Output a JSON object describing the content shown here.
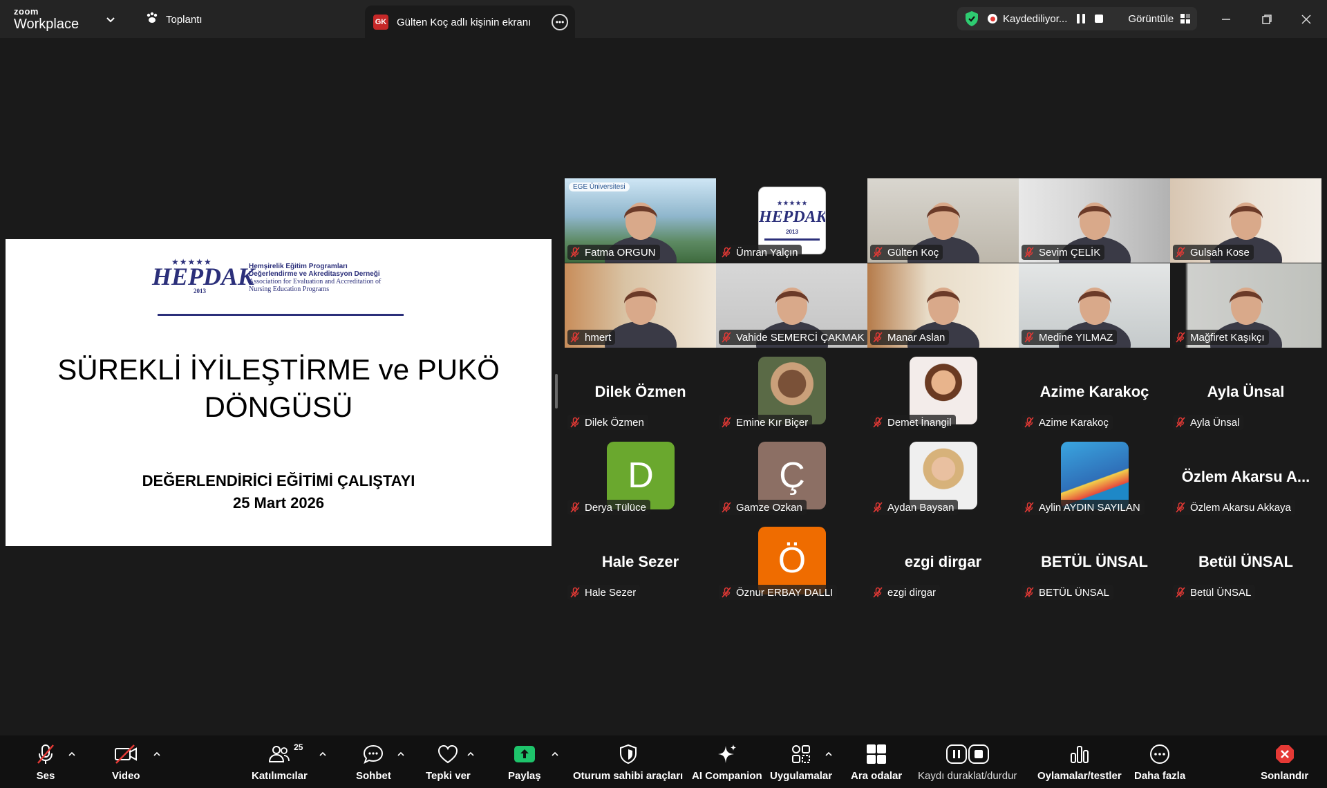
{
  "titlebar": {
    "brand_top": "zoom",
    "brand_bottom": "Workplace",
    "meeting_label": "Toplantı",
    "share_tab_badge": "GK",
    "share_tab_label": "Gülten Koç adlı kişinin ekranı",
    "recording_text": "Kaydediliyor...",
    "view_label": "Görüntüle"
  },
  "slide": {
    "logo_word": "HEPDAK",
    "logo_year": "2013",
    "logo_stars": "★★★★★",
    "logo_line1": "Hemşirelik Eğitim Programları",
    "logo_line2": "Değerlendirme ve Akreditasyon Derneği",
    "logo_line3": "Association for Evaluation and Accreditation of",
    "logo_line4": "Nursing Education Programs",
    "title_line1": "SÜREKLİ İYİLEŞTİRME ve PUKÖ",
    "title_line2": "DÖNGÜSÜ",
    "subtitle_line1": "DEĞERLENDİRİCİ EĞİTİMİ ÇALIŞTAYI",
    "subtitle_line2": "25 Mart 2026"
  },
  "participants": [
    {
      "name": "Fatma ORGUN",
      "kind": "video",
      "logo_text": "EGE Üniversitesi"
    },
    {
      "name": "Ümran Yalçın",
      "kind": "logo",
      "logo_word": "HEPDAK",
      "logo_year": "2013",
      "logo_stars": "★★★★★"
    },
    {
      "name": "Gülten Koç",
      "kind": "video",
      "active": true
    },
    {
      "name": "Sevim ÇELİK",
      "kind": "video"
    },
    {
      "name": "Gulsah Kose",
      "kind": "video"
    },
    {
      "name": "hmert",
      "kind": "video"
    },
    {
      "name": "Vahide SEMERCİ ÇAKMAK",
      "kind": "video"
    },
    {
      "name": "Manar Aslan",
      "kind": "video"
    },
    {
      "name": "Medine YILMAZ",
      "kind": "video"
    },
    {
      "name": "Mağfiret Kaşıkçı",
      "kind": "video"
    },
    {
      "name": "Dilek Özmen",
      "kind": "text",
      "big": "Dilek Özmen"
    },
    {
      "name": "Emine Kır Biçer",
      "kind": "photo"
    },
    {
      "name": "Demet İnangil",
      "kind": "photo"
    },
    {
      "name": "Azime Karakoç",
      "kind": "text",
      "big": "Azime Karakoç"
    },
    {
      "name": "Ayla Ünsal",
      "kind": "text",
      "big": "Ayla Ünsal"
    },
    {
      "name": "Derya Tülüce",
      "kind": "letter",
      "letter": "D",
      "color": "#6aa82e"
    },
    {
      "name": "Gamze Ozkan",
      "kind": "letter",
      "letter": "Ç",
      "color": "#8c6f64"
    },
    {
      "name": "Aydan Baysan",
      "kind": "photo"
    },
    {
      "name": "Aylin AYDIN SAYILAN",
      "kind": "photo"
    },
    {
      "name": "Özlem Akarsu Akkaya",
      "kind": "text",
      "big": "Özlem  Akarsu  A..."
    },
    {
      "name": "Hale Sezer",
      "kind": "text",
      "big": "Hale Sezer"
    },
    {
      "name": "Öznur ERBAY DALLI",
      "kind": "letter",
      "letter": "Ö",
      "color": "#ef6c00"
    },
    {
      "name": "ezgi dirgar",
      "kind": "text",
      "big": "ezgi dirgar"
    },
    {
      "name": "BETÜL ÜNSAL",
      "kind": "text",
      "big": "BETÜL ÜNSAL"
    },
    {
      "name": "Betül ÜNSAL",
      "kind": "text",
      "big": "Betül ÜNSAL"
    }
  ],
  "toolbar": {
    "audio": "Ses",
    "video": "Video",
    "participants": "Katılımcılar",
    "participants_count": "25",
    "chat": "Sohbet",
    "react": "Tepki ver",
    "share": "Paylaş",
    "host_tools": "Oturum sahibi araçları",
    "ai_companion": "AI Companion",
    "apps": "Uygulamalar",
    "breakout": "Ara odalar",
    "record": "Kaydı duraklat/durdur",
    "polls": "Oylamalar/testler",
    "more": "Daha fazla",
    "end": "Sonlandır"
  },
  "colors": {
    "active_speaker": "#2ecc71",
    "share_green": "#1ec46b",
    "end_red": "#e53935",
    "recording_red": "#e53935",
    "brand_navy": "#2b2f7a"
  }
}
